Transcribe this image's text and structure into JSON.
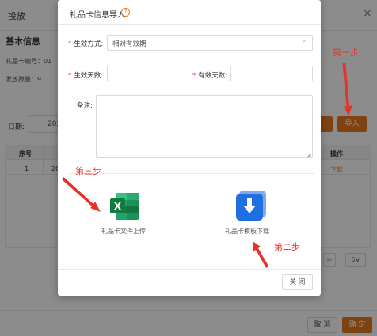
{
  "background": {
    "header_title": "投放",
    "close_icon": "×",
    "section_title": "基本信息",
    "card_no_label": "礼品卡编号：01",
    "quantity_label": "发放数量：9",
    "date_label": "日期:",
    "date_value": "202",
    "import_button": "导入",
    "table": {
      "headers": [
        "序号",
        "操作"
      ],
      "rows": [
        {
          "no": "1",
          "col2": "20",
          "action": "下载"
        }
      ]
    },
    "pagination": {
      "next": ">",
      "page_size": "5"
    },
    "cancel_button": "取 消",
    "confirm_button": "确 定"
  },
  "modal": {
    "title": "礼品卡信息导入",
    "help_icon": "?",
    "effect_mode_label": "生效方式:",
    "effect_mode_value": "相对有效期",
    "effect_days_label": "生效天数:",
    "valid_days_label": "有效天数:",
    "remark_label": "备注:",
    "upload_label": "礼品卡文件上传",
    "template_label": "礼品卡模板下载",
    "close_button": "关 闭"
  },
  "annotations": {
    "step1": "第一步",
    "step2": "第二步",
    "step3": "第三步"
  },
  "colors": {
    "accent": "#e67a1f",
    "annotation_red": "#e6332a",
    "excel_green": "#21a366",
    "template_blue": "#1f6fe0"
  },
  "icons": [
    "excel-file-icon",
    "download-icon",
    "help-icon",
    "chevron-down-icon",
    "close-icon"
  ]
}
